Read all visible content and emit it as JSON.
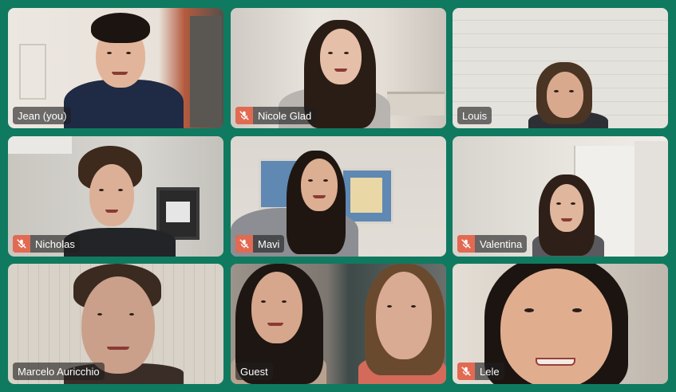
{
  "meeting": {
    "participants": [
      {
        "name": "Jean (you)",
        "muted": false
      },
      {
        "name": "Nicole Glad",
        "muted": true
      },
      {
        "name": "Louis",
        "muted": false
      },
      {
        "name": "Nicholas",
        "muted": true
      },
      {
        "name": "Mavi",
        "muted": true
      },
      {
        "name": "Valentina",
        "muted": true
      },
      {
        "name": "Marcelo Auricchio",
        "muted": false
      },
      {
        "name": "Guest",
        "muted": false
      },
      {
        "name": "Lele",
        "muted": true
      }
    ]
  },
  "colors": {
    "background": "#0f7a5f",
    "muted_badge": "#e26a52",
    "name_tag_bg": "#1e1e1e"
  },
  "icons": {
    "mic_off": "mic-off-icon"
  }
}
